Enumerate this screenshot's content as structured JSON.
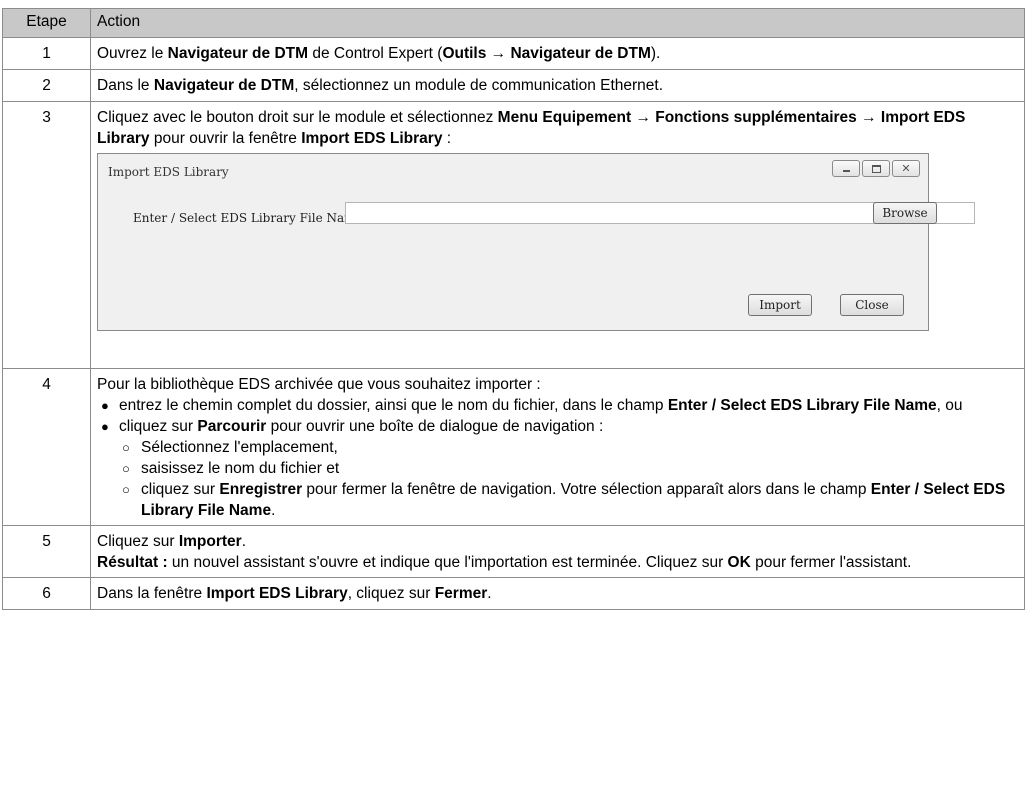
{
  "table": {
    "header": {
      "step": "Etape",
      "action": "Action"
    },
    "rows": [
      {
        "num": "1",
        "parts": [
          "Ouvrez le ",
          "Navigateur de DTM",
          " de Control Expert (",
          "Outils → Navigateur de DTM",
          ")."
        ]
      },
      {
        "num": "2",
        "parts": [
          "Dans le ",
          "Navigateur de DTM",
          ", sélectionnez un module de communication Ethernet."
        ]
      },
      {
        "num": "3",
        "parts": [
          "Cliquez avec le bouton droit sur le module et sélectionnez ",
          "Menu Equipement → Fonctions supplémentaires → Import EDS Library",
          " pour ouvrir la fenêtre ",
          "Import EDS Library",
          " :"
        ]
      },
      {
        "num": "4",
        "intro": "Pour la bibliothèque EDS archivée que vous souhaitez importer :",
        "bullet1": [
          "entrez le chemin complet du dossier, ainsi que le nom du fichier, dans le champ ",
          "Enter / Select EDS Library File Name",
          ", ou"
        ],
        "bullet2": [
          "cliquez sur ",
          "Parcourir",
          " pour ouvrir une boîte de dialogue de navigation :"
        ],
        "sub1": "Sélectionnez l'emplacement,",
        "sub2": "saisissez le nom du fichier et",
        "sub3": [
          "cliquez sur ",
          "Enregistrer",
          " pour fermer la fenêtre de navigation. Votre sélection apparaît alors dans le champ ",
          "Enter / Select EDS Library File Name",
          "."
        ]
      },
      {
        "num": "5",
        "line1": [
          "Cliquez sur ",
          "Importer",
          "."
        ],
        "line2": [
          "Résultat :",
          " un nouvel assistant s'ouvre et indique que l'importation est terminée. Cliquez sur ",
          "OK",
          " pour fermer l'assistant."
        ]
      },
      {
        "num": "6",
        "parts": [
          "Dans la fenêtre ",
          "Import EDS Library",
          ", cliquez sur ",
          "Fermer",
          "."
        ]
      }
    ]
  },
  "dialog": {
    "title": "Import EDS Library",
    "field_label": "Enter / Select EDS Library File Name:",
    "field_value": "",
    "browse_label": "Browse",
    "import_label": "Import",
    "close_label": "Close"
  }
}
